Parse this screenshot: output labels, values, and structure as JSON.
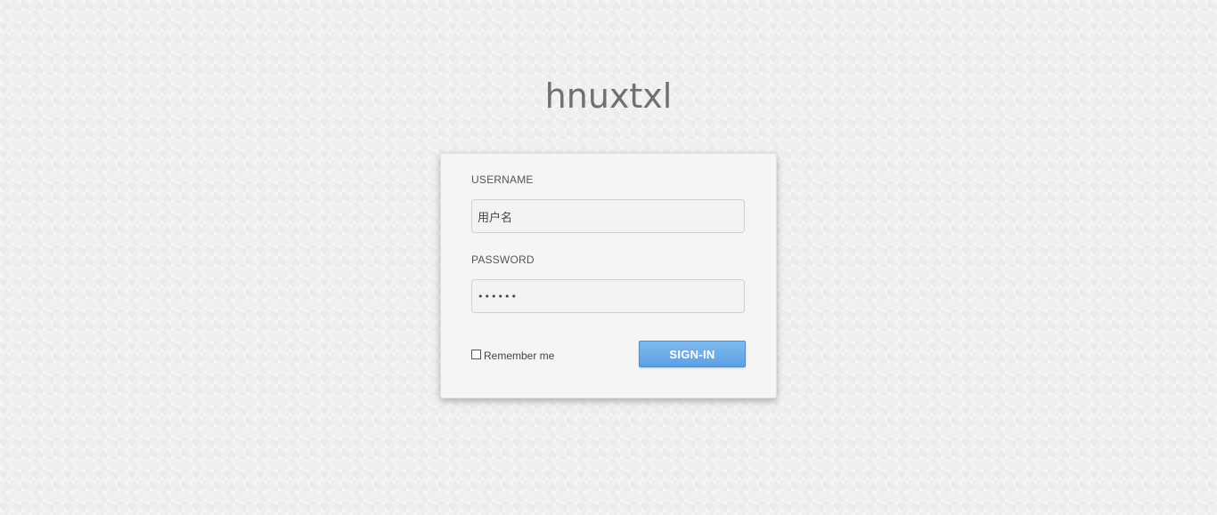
{
  "header": {
    "site_title": "hnuxtxl"
  },
  "login_form": {
    "username_label": "USERNAME",
    "username_value": "用户名",
    "password_label": "PASSWORD",
    "password_value": "••••••",
    "remember_label": "Remember me",
    "remember_checked": false,
    "signin_label": "SIGN-IN"
  },
  "colors": {
    "background": "#efefef",
    "card_background": "#f5f5f5",
    "button_top": "#7fb9ee",
    "button_bottom": "#5da0e2",
    "title_text": "#707070"
  }
}
